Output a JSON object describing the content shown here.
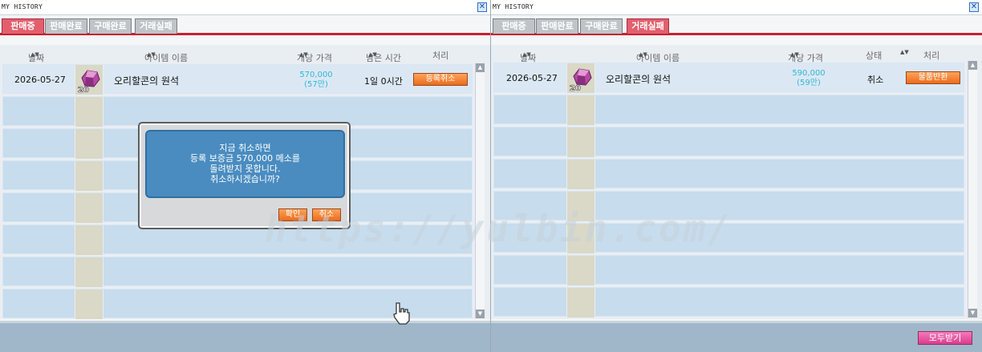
{
  "left_window": {
    "title": "MY HISTORY",
    "close_glyph": "✕",
    "tabs": [
      {
        "label": "판매중",
        "active": true
      },
      {
        "label": "판매완료",
        "active": false
      },
      {
        "label": "구매완료",
        "active": false
      },
      {
        "label": "거래실패",
        "active": false
      }
    ],
    "columns": {
      "date": "날짜",
      "item_name": "아이템 이름",
      "unit_price": "개당 가격",
      "time_left": "남은 시간",
      "action": "처리"
    },
    "rows": [
      {
        "date": "2026-05-27",
        "item_name": "오리할콘의 원석",
        "quantity": "20",
        "price": "570,000",
        "price_short": "(57만)",
        "time_left": "1일 0시간",
        "action_label": "등록취소",
        "icon": "ore-gem-icon"
      }
    ],
    "dialog": {
      "lines": [
        "지금 취소하면",
        "등록 보증금 570,000 메소를",
        "돌려받지 못합니다.",
        "취소하시겠습니까?"
      ],
      "confirm_label": "확인",
      "cancel_label": "취소"
    }
  },
  "right_window": {
    "title": "MY HISTORY",
    "close_glyph": "✕",
    "tabs": [
      {
        "label": "판매중",
        "active": false
      },
      {
        "label": "판매완료",
        "active": false
      },
      {
        "label": "구매완료",
        "active": false
      },
      {
        "label": "거래실패",
        "active": true
      }
    ],
    "columns": {
      "date": "날짜",
      "item_name": "아이템 이름",
      "unit_price": "개당 가격",
      "status": "상태",
      "action": "처리"
    },
    "rows": [
      {
        "date": "2026-05-27",
        "item_name": "오리할콘의 원석",
        "quantity": "20",
        "price": "590,000",
        "price_short": "(59만)",
        "status": "취소",
        "action_label": "물품반환",
        "icon": "ore-gem-icon"
      }
    ],
    "footer_button": "모두받기"
  },
  "watermark": "https://yulbin.com/",
  "colors": {
    "active_tab": "#e35f6e",
    "tab_underline": "#c7202e",
    "row_bg": "#c7dced",
    "price_text": "#31b6d8",
    "action_button": "#ea6c1d",
    "dialog_bg": "#4a8cc0",
    "footer_button": "#d83d8e"
  }
}
